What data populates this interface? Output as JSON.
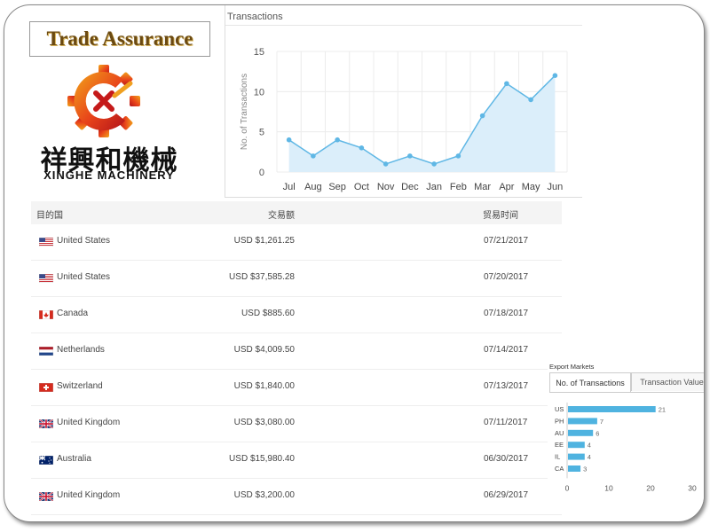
{
  "brand": {
    "badge": "Trade Assurance",
    "company_cn": "祥興和機械",
    "company_en": "XINGHE MACHINERY",
    "logo_glyph": "X"
  },
  "transactions_panel": {
    "title": "Transactions"
  },
  "chart_data": [
    {
      "type": "area",
      "title": "",
      "xlabel": "",
      "ylabel": "No. of Transactions",
      "categories": [
        "Jul",
        "Aug",
        "Sep",
        "Oct",
        "Nov",
        "Dec",
        "Jan",
        "Feb",
        "Mar",
        "Apr",
        "May",
        "Jun"
      ],
      "values": [
        4,
        2,
        4,
        3,
        1,
        2,
        1,
        2,
        7,
        11,
        9,
        12
      ],
      "ylim": [
        0,
        15
      ],
      "yticks": [
        0,
        5,
        10,
        15
      ],
      "grid": true,
      "color": "#5fb7e5",
      "fill": "#dbeefa"
    },
    {
      "type": "bar",
      "orientation": "horizontal",
      "title": "",
      "categories": [
        "US",
        "PH",
        "AU",
        "EE",
        "IL",
        "CA"
      ],
      "values": [
        21,
        7,
        6,
        4,
        4,
        3
      ],
      "xlim": [
        0,
        30
      ],
      "xticks": [
        0,
        10,
        20,
        30
      ],
      "color": "#4fb3e0"
    }
  ],
  "table": {
    "headers": {
      "country": "目的国",
      "amount": "交易额",
      "date": "贸易时间"
    },
    "rows": [
      {
        "flag": "us",
        "country": "United States",
        "amount": "USD $1,261.25",
        "date": "07/21/2017"
      },
      {
        "flag": "us",
        "country": "United States",
        "amount": "USD $37,585.28",
        "date": "07/20/2017"
      },
      {
        "flag": "ca",
        "country": "Canada",
        "amount": "USD $885.60",
        "date": "07/18/2017"
      },
      {
        "flag": "nl",
        "country": "Netherlands",
        "amount": "USD $4,009.50",
        "date": "07/14/2017"
      },
      {
        "flag": "ch",
        "country": "Switzerland",
        "amount": "USD $1,840.00",
        "date": "07/13/2017"
      },
      {
        "flag": "gb",
        "country": "United Kingdom",
        "amount": "USD $3,080.00",
        "date": "07/11/2017"
      },
      {
        "flag": "au",
        "country": "Australia",
        "amount": "USD $15,980.40",
        "date": "06/30/2017"
      },
      {
        "flag": "gb",
        "country": "United Kingdom",
        "amount": "USD $3,200.00",
        "date": "06/29/2017"
      }
    ]
  },
  "export_markets": {
    "title": "Export Markets",
    "tabs": [
      "No. of Transactions",
      "Transaction Value"
    ],
    "active_tab": 0
  }
}
